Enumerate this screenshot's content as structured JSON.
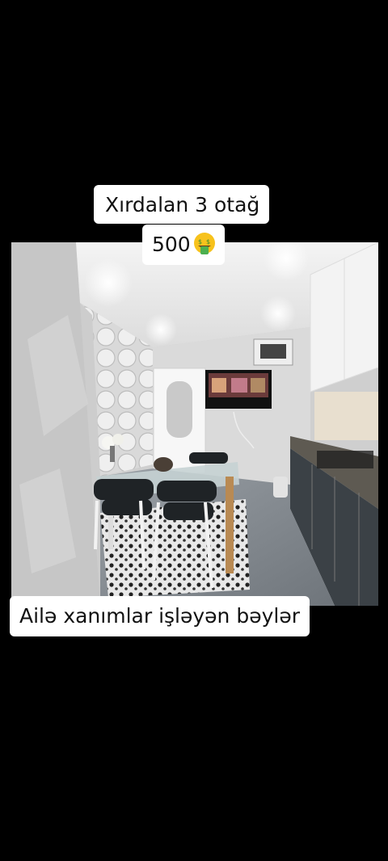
{
  "overlay": {
    "title": "Xırdalan 3 otağ",
    "price": "500",
    "price_emoji": "money-mouth-face-icon",
    "bottom_text": "Ailə xanımlar işləyən bəylər"
  },
  "colors": {
    "background": "#000000",
    "caption_bg": "#ffffff",
    "caption_text": "#111111"
  }
}
